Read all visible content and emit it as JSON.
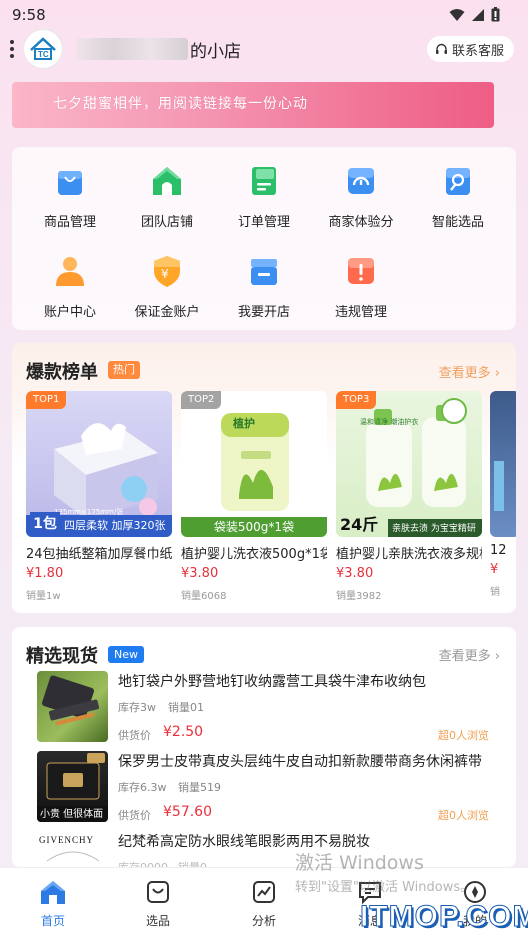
{
  "status": {
    "time": "9:58"
  },
  "header": {
    "shop_name_suffix": "的小店",
    "customer_service": "联系客服"
  },
  "banner": {
    "text": "七夕甜蜜相伴，用阅读链接每一份心动"
  },
  "menu": [
    {
      "label": "商品管理",
      "icon": "bag-icon",
      "color": "#3a8ff0"
    },
    {
      "label": "团队店铺",
      "icon": "house-icon",
      "color": "#2bbf6a"
    },
    {
      "label": "订单管理",
      "icon": "document-icon",
      "color": "#2bbf6a"
    },
    {
      "label": "商家体验分",
      "icon": "gauge-icon",
      "color": "#3a8ff0"
    },
    {
      "label": "智能选品",
      "icon": "magnifier-icon",
      "color": "#3a8ff0"
    },
    {
      "label": "账户中心",
      "icon": "user-icon",
      "color": "#ff9a2e"
    },
    {
      "label": "保证金账户",
      "icon": "shield-yen-icon",
      "color": "#ffa629"
    },
    {
      "label": "我要开店",
      "icon": "store-icon",
      "color": "#3a8ff0"
    },
    {
      "label": "违规管理",
      "icon": "warning-icon",
      "color": "#ff6a4d"
    }
  ],
  "hot": {
    "title": "爆款榜单",
    "tag": "热门",
    "more": "查看更多 ›",
    "products": [
      {
        "rank": "TOP1",
        "name": "24包抽纸整箱加厚餐巾纸",
        "price": "¥1.80",
        "sales": "销量1w",
        "img_caption": "四层柔软 加厚320张",
        "img_badge": "1包",
        "img_small": "135mm×175mm/张"
      },
      {
        "rank": "TOP2",
        "name": "植护婴儿洗衣液500g*1袋",
        "price": "¥3.80",
        "sales": "销量6068",
        "img_caption": "袋装500g*1袋",
        "img_brand": "植护"
      },
      {
        "rank": "TOP3",
        "name": "植护婴儿亲肤洗衣液多规格",
        "price": "¥3.80",
        "sales": "销量3982",
        "img_caption": "亲肤去渍 为宝宝精研",
        "img_badge": "24斤",
        "img_top": "温和清净 潮油护衣"
      },
      {
        "rank": "",
        "name": "12",
        "price": "¥",
        "sales": "销"
      }
    ]
  },
  "selected": {
    "title": "精选现货",
    "tag": "New",
    "more": "查看更多 ›",
    "items": [
      {
        "title": "地钉袋户外野营地钉收纳露营工具袋牛津布收纳包",
        "stock": "库存3w",
        "sold": "销量01",
        "price_label": "供货价",
        "price": "¥2.50",
        "views": "超0人浏览"
      },
      {
        "title": "保罗男士皮带真皮头层纯牛皮自动扣新款腰带商务休闲裤带",
        "stock": "库存6.3w",
        "sold": "销量519",
        "price_label": "供货价",
        "price": "¥57.60",
        "views": "超0人浏览",
        "img_caption": "小贵 但很体面"
      },
      {
        "title": "纪梵希高定防水眼线笔眼影两用不易脱妆",
        "stock": "库存0000",
        "sold": "销量0",
        "price_label": "",
        "price": "",
        "views": "",
        "img_brand": "GIVENCHY"
      }
    ]
  },
  "tabs": [
    {
      "label": "首页",
      "icon": "home-icon",
      "active": true
    },
    {
      "label": "选品",
      "icon": "select-icon",
      "active": false
    },
    {
      "label": "分析",
      "icon": "chart-icon",
      "active": false
    },
    {
      "label": "消息",
      "icon": "message-icon",
      "active": false
    },
    {
      "label": "我的",
      "icon": "compass-icon",
      "active": false
    }
  ],
  "watermark": {
    "line1": "激活 Windows",
    "line2": "转到\"设置\"以激活 Windows。",
    "site": "ITMOP.COM"
  }
}
